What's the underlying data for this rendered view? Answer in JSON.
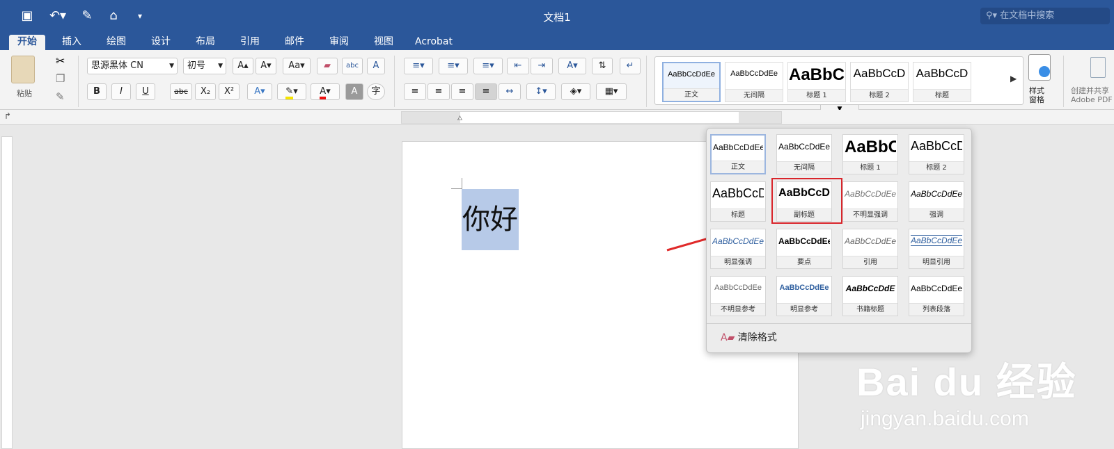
{
  "app": {
    "doc_title": "文档1",
    "search_placeholder": "在文档中搜索"
  },
  "qat": {
    "save_icon": "save-icon",
    "undo_icon": "undo-icon",
    "edit_icon": "edit-icon",
    "home_icon": "home-icon",
    "more_icon": "chevron-down-icon"
  },
  "tabs": [
    "开始",
    "插入",
    "绘图",
    "设计",
    "布局",
    "引用",
    "邮件",
    "审阅",
    "视图",
    "Acrobat"
  ],
  "ribbon": {
    "paste": "粘贴",
    "font_name": "思源黑体 CN",
    "font_size": "初号",
    "bold": "B",
    "italic": "I",
    "underline": "U",
    "strike": "abc",
    "sub": "X₂",
    "sup": "X²",
    "case": "Aa",
    "styles_pane": "样式\n窗格",
    "adobe": "创建并共享\nAdobe PDF"
  },
  "gallery": [
    {
      "preview": "AaBbCcDdEe",
      "name": "正文"
    },
    {
      "preview": "AaBbCcDdEe",
      "name": "无间隔"
    },
    {
      "preview": "AaBbC",
      "name": "标题 1"
    },
    {
      "preview": "AaBbCcD",
      "name": "标题 2"
    },
    {
      "preview": "AaBbCcD",
      "name": "标题"
    }
  ],
  "document": {
    "text": "你好"
  },
  "styles_popup": {
    "rows": [
      [
        {
          "preview": "AaBbCcDdEe",
          "name": "正文"
        },
        {
          "preview": "AaBbCcDdEe",
          "name": "无间隔"
        },
        {
          "preview": "AaBbC",
          "name": "标题 1"
        },
        {
          "preview": "AaBbCcD",
          "name": "标题 2"
        }
      ],
      [
        {
          "preview": "AaBbCcD",
          "name": "标题"
        },
        {
          "preview": "AaBbCcD",
          "name": "副标题"
        },
        {
          "preview": "AaBbCcDdEe",
          "name": "不明显强调"
        },
        {
          "preview": "AaBbCcDdEe",
          "name": "强调"
        }
      ],
      [
        {
          "preview": "AaBbCcDdEe",
          "name": "明显强调"
        },
        {
          "preview": "AaBbCcDdEe",
          "name": "要点"
        },
        {
          "preview": "AaBbCcDdEe",
          "name": "引用"
        },
        {
          "preview": "AaBbCcDdEe",
          "name": "明显引用"
        }
      ],
      [
        {
          "preview": "AaBbCcDdEe",
          "name": "不明显参考"
        },
        {
          "preview": "AaBbCcDdEe",
          "name": "明显参考"
        },
        {
          "preview": "AaBbCcDdE",
          "name": "书籍标题"
        },
        {
          "preview": "AaBbCcDdEe",
          "name": "列表段落"
        }
      ]
    ],
    "clear_formatting": "清除格式"
  },
  "watermark": {
    "brand": "Bai du 经验",
    "url": "jingyan.baidu.com"
  },
  "colors": {
    "accent": "#2b579a",
    "highlight_box": "#d9252b",
    "selection": "#b7cae8"
  }
}
